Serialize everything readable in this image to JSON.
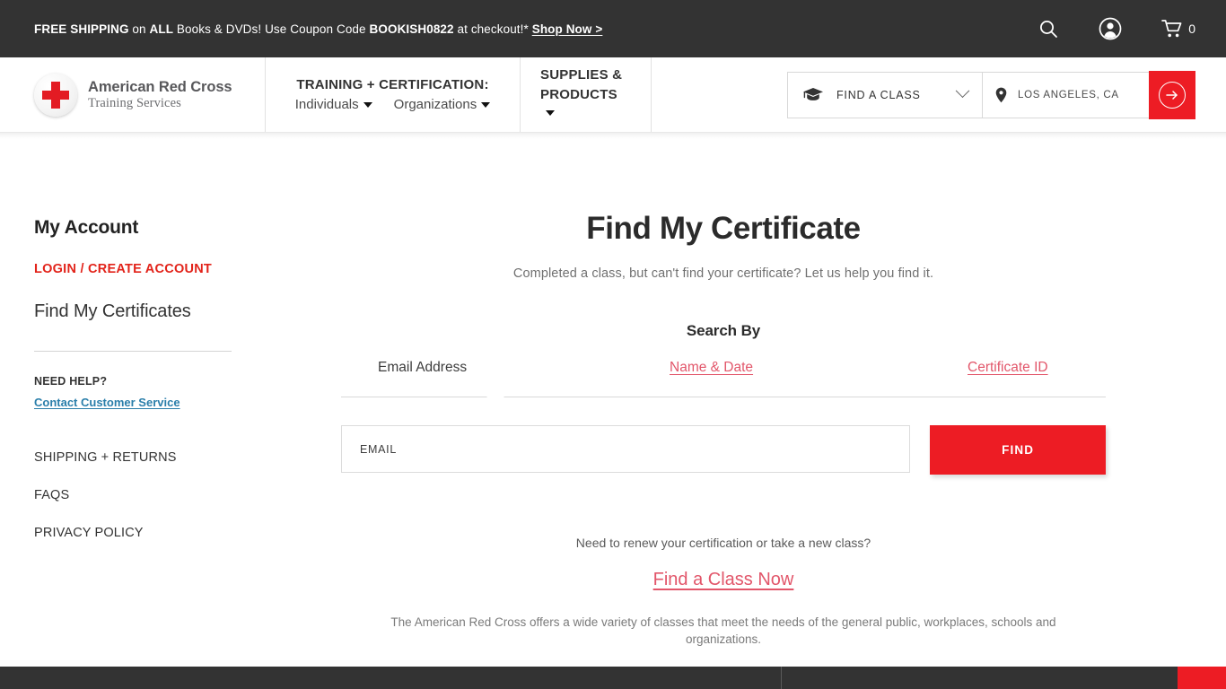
{
  "promo": {
    "part1_bold": "FREE SHIPPING",
    "part2": " on ",
    "part3_bold": "ALL",
    "part4": " Books & DVDs! Use Coupon Code ",
    "part5_bold": "BOOKISH0822",
    "part6": " at checkout!* ",
    "link": "Shop Now >",
    "icons": {
      "search": "search-icon",
      "account": "account-icon",
      "cart": "cart-icon"
    },
    "cart_count": "0"
  },
  "header": {
    "logo": {
      "line1": "American Red Cross",
      "line2": "Training Services",
      "mark": "red-cross-icon"
    },
    "nav": {
      "training_title": "TRAINING + CERTIFICATION:",
      "training_items": [
        {
          "label": "Individuals"
        },
        {
          "label": "Organizations"
        }
      ],
      "supplies_title": "SUPPLIES & PRODUCTS"
    },
    "search": {
      "class_icon": "graduation-cap-icon",
      "class_label": "FIND A CLASS",
      "chevron": "chevron-down-icon",
      "location_icon": "map-pin-icon",
      "location_value": "LOS ANGELES, CA",
      "go_icon": "arrow-right-circle-icon"
    }
  },
  "sidebar": {
    "title": "My Account",
    "login": "LOGIN / CREATE ACCOUNT",
    "current": "Find My Certificates",
    "need_help": "NEED HELP?",
    "contact": "Contact Customer Service",
    "links": [
      {
        "label": "SHIPPING + RETURNS"
      },
      {
        "label": "FAQS"
      },
      {
        "label": "PRIVACY POLICY"
      }
    ]
  },
  "main": {
    "heading": "Find My Certificate",
    "subheading": "Completed a class, but can't find your certificate? Let us help you find it.",
    "search_by": "Search By",
    "tabs": [
      {
        "label": "Email Address",
        "active": true
      },
      {
        "label": "Name & Date",
        "active": false
      },
      {
        "label": "Certificate ID",
        "active": false
      }
    ],
    "form": {
      "email_placeholder": "EMAIL",
      "email_value": "",
      "find_label": "FIND"
    },
    "renew_prompt": "Need to renew your certification or take a new class?",
    "find_class_link": "Find a Class Now",
    "blurb": "The American Red Cross offers a wide variety of classes that meet the needs of the general public, workplaces, schools and organizations."
  },
  "colors": {
    "brand_red": "#ed1c24",
    "accent_red": "#e2231a",
    "link_pink": "#e2566a",
    "link_blue": "#2a7eaa",
    "dark_bar": "#333333"
  }
}
